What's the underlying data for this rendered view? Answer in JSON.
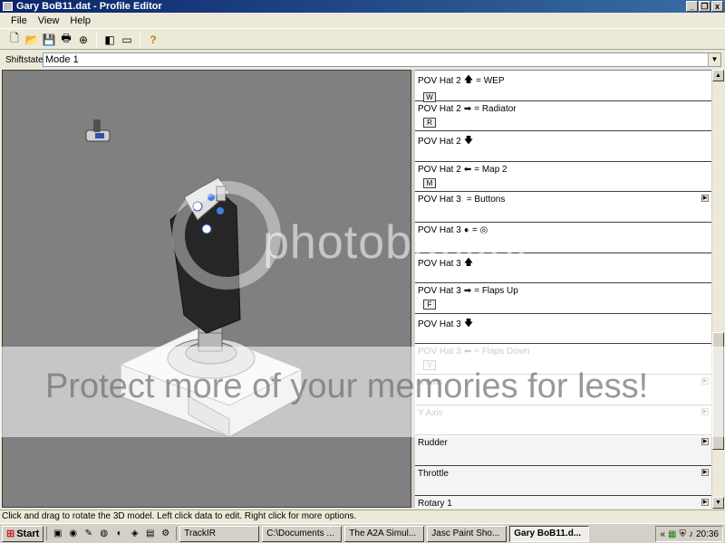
{
  "window": {
    "title": "Gary BoB11.dat - Profile Editor"
  },
  "window_buttons": [
    "_",
    "❐",
    "x"
  ],
  "menu": {
    "items": [
      "File",
      "View",
      "Help"
    ]
  },
  "toolbar": {
    "buttons": [
      {
        "name": "new-icon",
        "glyph": "🗋"
      },
      {
        "name": "open-icon",
        "glyph": "📂"
      },
      {
        "name": "save-icon",
        "glyph": "💾"
      },
      {
        "name": "print-icon",
        "glyph": "🖶"
      },
      {
        "name": "test-icon",
        "glyph": "⊕"
      },
      {
        "name": "view-split-icon",
        "glyph": "◧"
      },
      {
        "name": "view-single-icon",
        "glyph": "▭"
      },
      {
        "name": "help-icon",
        "glyph": "?"
      }
    ]
  },
  "shiftstate": {
    "label": "Shiftstate",
    "value": "Mode 1"
  },
  "profile_rows": [
    {
      "prefix": "POV Hat 2",
      "glyph": "🡅",
      "action": "= WEP",
      "key": "W",
      "expand": false,
      "dim": false,
      "gray": false
    },
    {
      "prefix": "POV Hat 2",
      "glyph": "➡",
      "action": "= Radiator",
      "key": "R",
      "expand": false,
      "dim": false,
      "gray": false
    },
    {
      "prefix": "POV Hat 2",
      "glyph": "🡇",
      "action": "",
      "key": "",
      "expand": false,
      "dim": false,
      "gray": false
    },
    {
      "prefix": "POV Hat 2",
      "glyph": "⬅",
      "action": "= Map 2",
      "key": "M",
      "expand": false,
      "dim": false,
      "gray": false
    },
    {
      "prefix": "POV Hat 3",
      "glyph": "",
      "action": "= Buttons",
      "key": "",
      "expand": true,
      "dim": false,
      "gray": false
    },
    {
      "prefix": "POV Hat 3",
      "glyph": "●",
      "action": "= ◎",
      "key": "",
      "expand": false,
      "dim": false,
      "gray": false
    },
    {
      "prefix": "POV Hat 3",
      "glyph": "🡅",
      "action": "",
      "key": "",
      "expand": false,
      "dim": false,
      "gray": false
    },
    {
      "prefix": "POV Hat 3",
      "glyph": "➡",
      "action": "= Flaps Up",
      "key": "F",
      "expand": false,
      "dim": false,
      "gray": false
    },
    {
      "prefix": "POV Hat 3",
      "glyph": "🡇",
      "action": "",
      "key": "",
      "expand": false,
      "dim": false,
      "gray": false
    },
    {
      "prefix": "POV Hat 3",
      "glyph": "⬅",
      "action": "= Flaps Down",
      "key": "V",
      "expand": false,
      "dim": true,
      "gray": false
    },
    {
      "prefix": "X Axis",
      "glyph": "",
      "action": "",
      "key": "",
      "expand": true,
      "dim": true,
      "gray": false
    },
    {
      "prefix": "Y Axis",
      "glyph": "",
      "action": "",
      "key": "",
      "expand": true,
      "dim": true,
      "gray": false
    },
    {
      "prefix": "Rudder",
      "glyph": "",
      "action": "",
      "key": "",
      "expand": true,
      "dim": false,
      "gray": true
    },
    {
      "prefix": "Throttle",
      "glyph": "",
      "action": "",
      "key": "",
      "expand": true,
      "dim": false,
      "gray": true
    },
    {
      "prefix": "Rotary 1",
      "glyph": "",
      "action": "",
      "key": "",
      "expand": true,
      "dim": false,
      "gray": true
    }
  ],
  "status": {
    "text": "Click and drag to rotate the 3D model. Left click data to edit. Right click for more options."
  },
  "taskbar": {
    "start": "Start",
    "tasks": [
      {
        "label": "TrackIR",
        "active": false
      },
      {
        "label": "C:\\Documents ...",
        "active": false
      },
      {
        "label": "The A2A Simul...",
        "active": false
      },
      {
        "label": "Jasc Paint Sho...",
        "active": false
      },
      {
        "label": "Gary BoB11.d...",
        "active": true
      }
    ],
    "clock": "20:36"
  },
  "watermark": {
    "top": "photobucket",
    "bottom": "Protect more of your memories for less!"
  }
}
